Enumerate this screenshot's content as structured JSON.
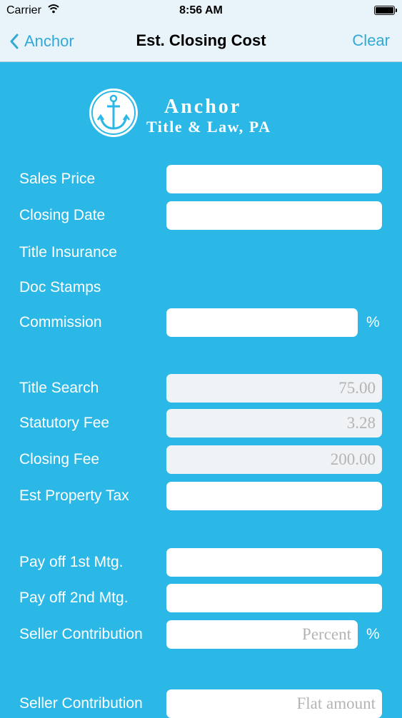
{
  "status_bar": {
    "carrier": "Carrier",
    "time": "8:56 AM"
  },
  "nav": {
    "back_label": "Anchor",
    "title": "Est. Closing Cost",
    "clear_label": "Clear"
  },
  "logo": {
    "line1": "Anchor",
    "line2": "Title & Law, PA"
  },
  "form": {
    "sales_price": {
      "label": "Sales Price",
      "value": ""
    },
    "closing_date": {
      "label": "Closing Date",
      "value": ""
    },
    "title_insurance": {
      "label": "Title Insurance"
    },
    "doc_stamps": {
      "label": "Doc Stamps"
    },
    "commission": {
      "label": "Commission",
      "value": "",
      "unit": "%"
    },
    "title_search": {
      "label": "Title Search",
      "value": "75.00"
    },
    "statutory_fee": {
      "label": "Statutory Fee",
      "value": "3.28"
    },
    "closing_fee": {
      "label": "Closing Fee",
      "value": "200.00"
    },
    "est_property_tax": {
      "label": "Est Property Tax",
      "value": ""
    },
    "payoff_1st": {
      "label": "Pay off 1st Mtg.",
      "value": ""
    },
    "payoff_2nd": {
      "label": "Pay off 2nd Mtg.",
      "value": ""
    },
    "seller_contribution_percent": {
      "label": "Seller Contribution",
      "placeholder": "Percent",
      "unit": "%"
    },
    "seller_contribution_flat": {
      "label": "Seller Contribution",
      "placeholder": "Flat amount"
    }
  }
}
